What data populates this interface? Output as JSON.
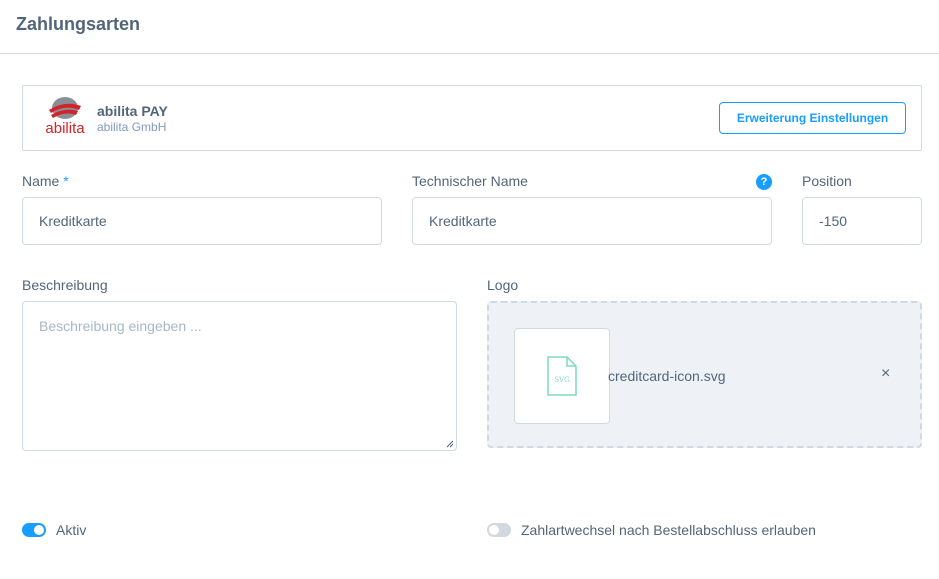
{
  "header": {
    "title": "Zahlungsarten"
  },
  "extension": {
    "name": "abilita PAY",
    "vendor": "abilita GmbH",
    "logo_text": "abilita",
    "settings_button": "Erweiterung Einstellungen"
  },
  "form": {
    "name": {
      "label": "Name",
      "required_mark": "*",
      "value": "Kreditkarte"
    },
    "technical_name": {
      "label": "Technischer Name",
      "value": "Kreditkarte",
      "help_icon": "?"
    },
    "position": {
      "label": "Position",
      "value": "-150"
    },
    "description": {
      "label": "Beschreibung",
      "placeholder": "Beschreibung eingeben ..."
    },
    "logo": {
      "label": "Logo",
      "file_name": "creditcard-icon.svg",
      "file_badge": "SVG",
      "remove_icon": "×"
    }
  },
  "toggles": {
    "active": {
      "label": "Aktiv",
      "checked": true
    },
    "allow_change": {
      "label": "Zahlartwechsel nach Bestellabschluss erlauben",
      "checked": false
    }
  },
  "colors": {
    "accent": "#189eff",
    "text": "#52667a",
    "border": "#d1d9e0",
    "logo_red": "#d2232a"
  }
}
